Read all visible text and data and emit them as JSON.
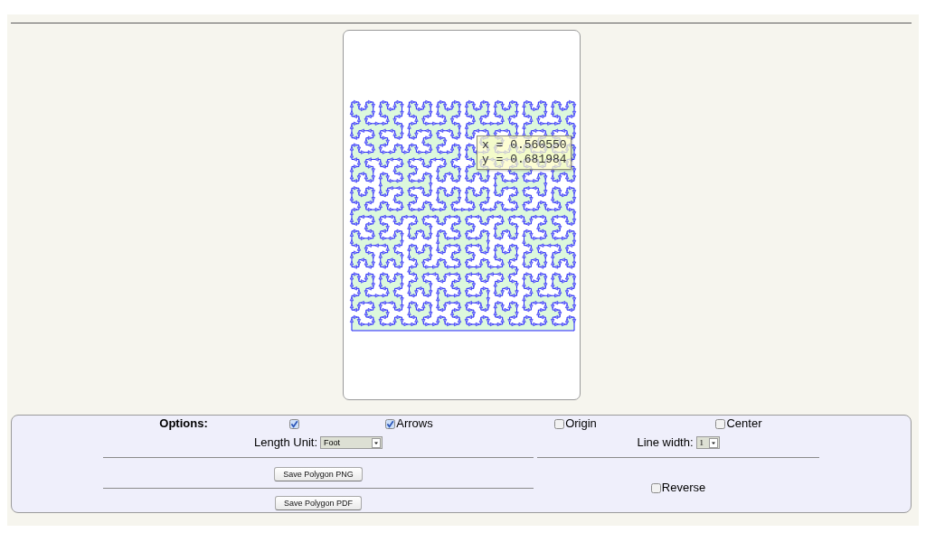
{
  "canvas": {
    "tooltip": {
      "lines": [
        "x = 0.560550",
        "y = 0.681984"
      ]
    }
  },
  "options": {
    "title": "Options:",
    "checkboxes": [
      {
        "checked": true
      },
      {
        "label": "Arrows",
        "checked": true
      },
      {
        "label": "Origin",
        "checked": false
      },
      {
        "label": "Center",
        "checked": false
      }
    ],
    "length_unit": {
      "label": "Length Unit:",
      "value": "Foot"
    },
    "line_width": {
      "label": "Line width:",
      "value": "1"
    },
    "buttons": [
      "Save Polygon PNG",
      "Save Polygon PDF"
    ],
    "reverse": {
      "label": "Reverse",
      "checked": false
    }
  }
}
